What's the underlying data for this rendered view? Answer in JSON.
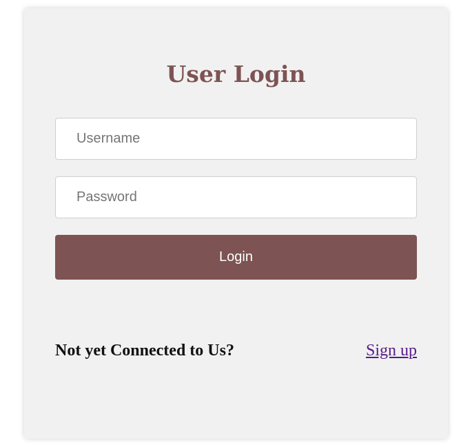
{
  "login_form": {
    "title": "User Login",
    "username": {
      "value": "",
      "placeholder": "Username"
    },
    "password": {
      "value": "",
      "placeholder": "Password"
    },
    "submit_label": "Login"
  },
  "footer": {
    "prompt": "Not yet Connected to Us?",
    "signup_link": "Sign up"
  },
  "colors": {
    "accent": "#7d5353",
    "card_background": "#f1f1f1",
    "link_visited": "#551a8b"
  }
}
